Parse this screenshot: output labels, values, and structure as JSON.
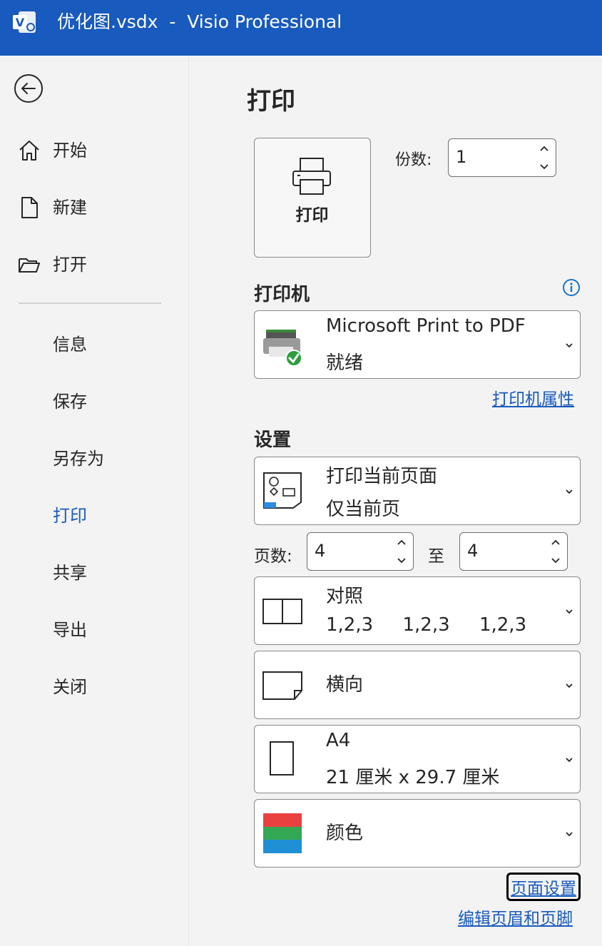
{
  "titlebar": {
    "title": "优化图.vsdx  -  Visio Professional",
    "app_letter": "V",
    "bg_color": "#185abd"
  },
  "sidebar": {
    "back_icon": "back-arrow-icon",
    "items": [
      {
        "label": "开始",
        "icon": "home-icon",
        "active": false
      },
      {
        "label": "新建",
        "icon": "new-document-icon",
        "active": false
      },
      {
        "label": "打开",
        "icon": "open-folder-icon",
        "active": false
      },
      {
        "label": "信息",
        "active": false
      },
      {
        "label": "保存",
        "active": false
      },
      {
        "label": "另存为",
        "active": false
      },
      {
        "label": "打印",
        "active": true
      },
      {
        "label": "共享",
        "active": false
      },
      {
        "label": "导出",
        "active": false
      },
      {
        "label": "关闭",
        "active": false
      }
    ],
    "accent_color": "#185abd"
  },
  "main": {
    "title": "打印",
    "print_button_label": "打印",
    "copies_label": "份数:",
    "copies_value": "1",
    "printer_heading": "打印机",
    "printer": {
      "name": "Microsoft Print to PDF",
      "status": "就绪"
    },
    "printer_properties_link": "打印机属性",
    "settings_heading": "设置",
    "print_range": {
      "title": "打印当前页面",
      "subtitle": "仅当前页"
    },
    "pages_label": "页数:",
    "pages_from": "4",
    "to_label": "至",
    "pages_to": "4",
    "collation": {
      "title": "对照",
      "subtitle": "1,2,3     1,2,3     1,2,3"
    },
    "orientation": {
      "title": "横向"
    },
    "paper_size": {
      "title": "A4",
      "subtitle": "21 厘米 x 29.7 厘米"
    },
    "color": {
      "title": "颜色",
      "swatches": [
        "#e94040",
        "#34a853",
        "#1f8fd6"
      ]
    },
    "page_setup_link": "页面设置",
    "header_footer_link": "编辑页眉和页脚"
  }
}
